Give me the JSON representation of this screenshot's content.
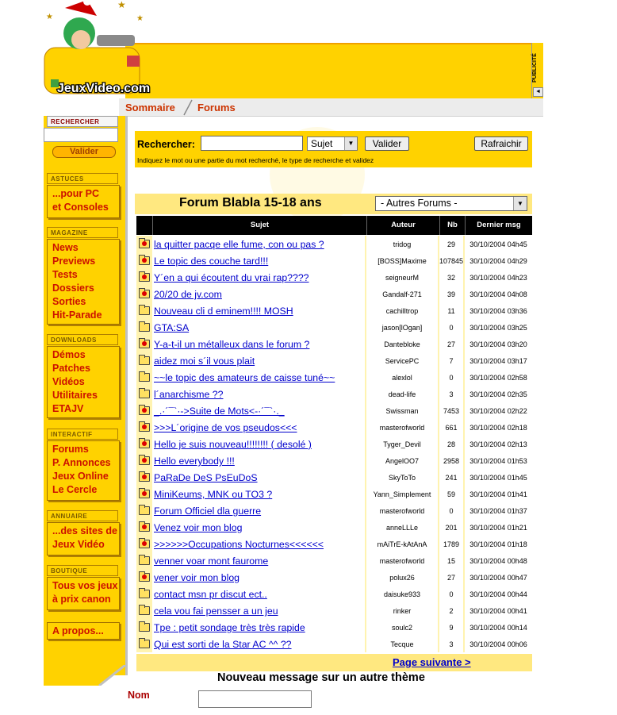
{
  "header": {
    "logo_text": "JeuxVideo.com",
    "pub_label": "PUBLICITÉ",
    "breadcrumb": [
      "Sommaire",
      "Forums"
    ]
  },
  "sidebar": {
    "search_title": "RECHERCHER",
    "search_button": "Valider",
    "sections": [
      {
        "title": "ASTUCES",
        "links": [
          "...pour PC",
          "et Consoles"
        ]
      },
      {
        "title": "MAGAZINE",
        "links": [
          "News",
          "Previews",
          "Tests",
          "Dossiers",
          "Sorties",
          "Hit-Parade"
        ]
      },
      {
        "title": "DOWNLOADS",
        "links": [
          "Démos",
          "Patches",
          "Vidéos",
          "Utilitaires",
          "ETAJV"
        ]
      },
      {
        "title": "INTERACTIF",
        "links": [
          "Forums",
          "P. Annonces",
          "Jeux Online",
          "Le Cercle"
        ]
      },
      {
        "title": "ANNUAIRE",
        "links": [
          "...des sites de",
          "Jeux Vidéo"
        ]
      },
      {
        "title": "BOUTIQUE",
        "links": [
          "Tous vos jeux",
          "à prix canon"
        ]
      }
    ],
    "apropos": "A propos..."
  },
  "search": {
    "label": "Rechercher:",
    "type_value": "Sujet",
    "submit": "Valider",
    "refresh": "Rafraichir",
    "hint": "Indiquez le mot ou une partie du mot recherché, le type de recherche et validez"
  },
  "forum": {
    "title": "Forum Blabla 15-18 ans",
    "other_forums": "- Autres Forums -",
    "columns": {
      "subject": "Sujet",
      "author": "Auteur",
      "count": "Nb",
      "last": "Dernier msg"
    },
    "topics": [
      {
        "subject": "la quitter pacqe elle fume, con ou pas ?",
        "author": "tridog",
        "nb": "29",
        "date": "30/10/2004 04h45",
        "hot": true
      },
      {
        "subject": "Le topic des couche tard!!!",
        "author": "[BOSS]Maxime",
        "nb": "107845",
        "date": "30/10/2004 04h29",
        "hot": true
      },
      {
        "subject": "Y´en a qui écoutent du vrai rap????",
        "author": "seigneurM",
        "nb": "32",
        "date": "30/10/2004 04h23",
        "hot": true
      },
      {
        "subject": "20/20 de jv.com",
        "author": "Gandalf-271",
        "nb": "39",
        "date": "30/10/2004 04h08",
        "hot": true
      },
      {
        "subject": "Nouveau cli d eminem!!!! MOSH",
        "author": "cachilltrop",
        "nb": "11",
        "date": "30/10/2004 03h36",
        "hot": false
      },
      {
        "subject": "GTA:SA",
        "author": "jason[lOgan]",
        "nb": "0",
        "date": "30/10/2004 03h25",
        "hot": false
      },
      {
        "subject": "Y-a-t-il un métalleux dans le forum ?",
        "author": "Dantebloke",
        "nb": "27",
        "date": "30/10/2004 03h20",
        "hot": true
      },
      {
        "subject": "aidez moi s´il vous plait",
        "author": "ServicePC",
        "nb": "7",
        "date": "30/10/2004 03h17",
        "hot": false
      },
      {
        "subject": "~~le topic des amateurs de caisse tuné~~",
        "author": "alexlol",
        "nb": "0",
        "date": "30/10/2004 02h58",
        "hot": false
      },
      {
        "subject": "l´anarchisme ??",
        "author": "dead-life",
        "nb": "3",
        "date": "30/10/2004 02h35",
        "hot": false
      },
      {
        "subject": "_.·´¯`·->Suite de Mots<-·´¯`·._",
        "author": "Swissman",
        "nb": "7453",
        "date": "30/10/2004 02h22",
        "hot": true
      },
      {
        "subject": ">>>L´origine de vos pseudos<<<",
        "author": "masterofworld",
        "nb": "661",
        "date": "30/10/2004 02h18",
        "hot": true
      },
      {
        "subject": "Hello je suis nouveau!!!!!!!! ( desolé )",
        "author": "Tyger_Devil",
        "nb": "28",
        "date": "30/10/2004 02h13",
        "hot": true
      },
      {
        "subject": "Hello everybody !!!",
        "author": "AngelOO7",
        "nb": "2958",
        "date": "30/10/2004 01h53",
        "hot": true
      },
      {
        "subject": "PaRaDe DeS PsEuDoS",
        "author": "SkyToTo",
        "nb": "241",
        "date": "30/10/2004 01h45",
        "hot": true
      },
      {
        "subject": "MiniKeums, MNK ou TO3 ?",
        "author": "Yann_Simplement",
        "nb": "59",
        "date": "30/10/2004 01h41",
        "hot": true
      },
      {
        "subject": "Forum Officiel dla guerre",
        "author": "masterofworld",
        "nb": "0",
        "date": "30/10/2004 01h37",
        "hot": false
      },
      {
        "subject": "Venez voir mon blog",
        "author": "anneLLLe",
        "nb": "201",
        "date": "30/10/2004 01h21",
        "hot": true
      },
      {
        "subject": ">>>>>>Occupations Nocturnes<<<<<<",
        "author": "mAiTrE-kAtAnA",
        "nb": "1789",
        "date": "30/10/2004 01h18",
        "hot": true
      },
      {
        "subject": "venner voar mont faurome",
        "author": "masterofworld",
        "nb": "15",
        "date": "30/10/2004 00h48",
        "hot": false
      },
      {
        "subject": "vener voir mon blog",
        "author": "polux26",
        "nb": "27",
        "date": "30/10/2004 00h47",
        "hot": true
      },
      {
        "subject": "contact msn pr discut ect..",
        "author": "daisuke933",
        "nb": "0",
        "date": "30/10/2004 00h44",
        "hot": false
      },
      {
        "subject": "cela vou fai pensser a un jeu",
        "author": "rinker",
        "nb": "2",
        "date": "30/10/2004 00h41",
        "hot": false
      },
      {
        "subject": "Tpe : petit sondage très très rapide",
        "author": "soulc2",
        "nb": "9",
        "date": "30/10/2004 00h14",
        "hot": false
      },
      {
        "subject": "Qui est sorti de la Star AC ^^ ??",
        "author": "Tecque",
        "nb": "3",
        "date": "30/10/2004 00h06",
        "hot": false
      }
    ],
    "next_page": "Page suivante >"
  },
  "newmsg": {
    "title": "Nouveau message sur un autre thème",
    "name_label": "Nom"
  },
  "colors": {
    "yellow": "#ffd200",
    "red_link": "#cc1100",
    "blue_link": "#0000cc"
  }
}
